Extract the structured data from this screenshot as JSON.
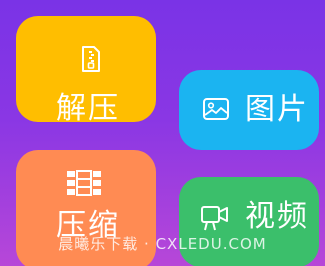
{
  "tiles": {
    "unzip": {
      "label": "解压",
      "icon": "zip-file-icon",
      "color": "#ffbe00"
    },
    "images": {
      "label": "图片",
      "icon": "image-icon",
      "color": "#1bb4f1"
    },
    "compress": {
      "label": "压缩",
      "icon": "compress-icon",
      "color": "#ff8b53"
    },
    "video": {
      "label": "视频",
      "icon": "video-camera-icon",
      "color": "#3bbf6b"
    }
  },
  "watermark": {
    "text": "晨曦乐下载 · CXLEDU.COM"
  },
  "colors": {
    "background_top": "#7a33e6",
    "background_bottom": "#b747d8"
  }
}
